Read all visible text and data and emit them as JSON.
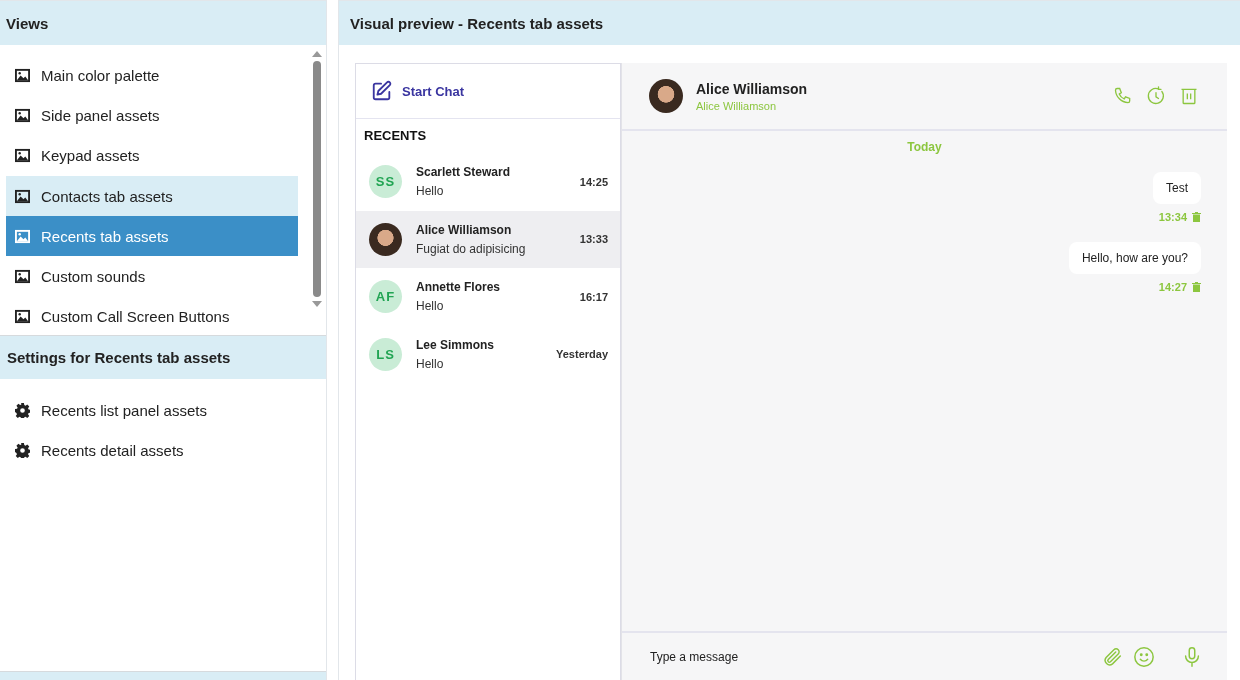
{
  "views_panel": {
    "title": "Views",
    "items": [
      {
        "label": "Main color palette",
        "selected": false,
        "hovered": false
      },
      {
        "label": "Side panel assets",
        "selected": false,
        "hovered": false
      },
      {
        "label": "Keypad assets",
        "selected": false,
        "hovered": false
      },
      {
        "label": "Contacts tab assets",
        "selected": false,
        "hovered": true
      },
      {
        "label": "Recents tab assets",
        "selected": true,
        "hovered": false
      },
      {
        "label": "Custom sounds",
        "selected": false,
        "hovered": false
      },
      {
        "label": "Custom Call Screen Buttons",
        "selected": false,
        "hovered": false
      }
    ]
  },
  "settings_panel": {
    "title": "Settings for Recents tab assets",
    "items": [
      {
        "label": "Recents list panel assets"
      },
      {
        "label": "Recents detail assets"
      }
    ]
  },
  "preview": {
    "title": "Visual preview - Recents tab assets",
    "start_chat": "Start Chat",
    "recents_heading": "RECENTS",
    "recents": [
      {
        "kind": "initials",
        "initials": "SS",
        "name": "Scarlett Steward",
        "message": "Hello",
        "time": "14:25",
        "selected": false
      },
      {
        "kind": "photo",
        "name": "Alice Williamson",
        "message": "Fugiat do adipisicing",
        "time": "13:33",
        "selected": true
      },
      {
        "kind": "initials",
        "initials": "AF",
        "name": "Annette Flores",
        "message": "Hello",
        "time": "16:17",
        "selected": false
      },
      {
        "kind": "initials",
        "initials": "LS",
        "name": "Lee Simmons",
        "message": "Hello",
        "time": "Yesterday",
        "selected": false
      }
    ],
    "chat": {
      "name": "Alice Williamson",
      "subtitle": "Alice Williamson",
      "day": "Today",
      "messages": [
        {
          "text": "Test",
          "time": "13:34"
        },
        {
          "text": "Hello, how are you?",
          "time": "14:27"
        }
      ],
      "input": {
        "placeholder": "Type a message"
      }
    }
  }
}
